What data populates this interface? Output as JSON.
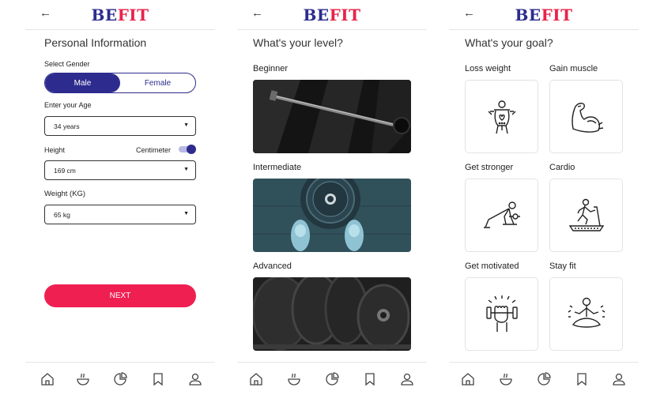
{
  "brand": {
    "be": "BE",
    "fit": "FIT"
  },
  "colors": {
    "brand_blue": "#2d2c8e",
    "brand_red": "#e8234a",
    "button_red": "#ef1f52"
  },
  "nav_icons": [
    "home-icon",
    "bowl-icon",
    "pie-chart-icon",
    "bookmark-icon",
    "profile-icon"
  ],
  "screen1": {
    "title": "Personal Information",
    "gender_label": "Select Gender",
    "gender_options": [
      "Male",
      "Female"
    ],
    "gender_selected": "Male",
    "age_label": "Enter your Age",
    "age_value": "34 years",
    "height_label": "Height",
    "height_unit": "Centimeter",
    "height_value": "169 cm",
    "weight_label": "Weight (KG)",
    "weight_value": "65 kg",
    "next_label": "NEXT"
  },
  "screen2": {
    "title": "What's your level?",
    "levels": [
      {
        "label": "Beginner"
      },
      {
        "label": "Intermediate"
      },
      {
        "label": "Advanced"
      }
    ]
  },
  "screen3": {
    "title": "What's your goal?",
    "goals": [
      {
        "label": "Loss weight",
        "icon": "weight-loss-icon"
      },
      {
        "label": "Gain muscle",
        "icon": "bicep-icon"
      },
      {
        "label": "Get stronger",
        "icon": "pushup-icon"
      },
      {
        "label": "Cardio",
        "icon": "treadmill-icon"
      },
      {
        "label": "Get motivated",
        "icon": "fist-dumbbell-icon"
      },
      {
        "label": "Stay fit",
        "icon": "meditation-icon"
      }
    ]
  }
}
